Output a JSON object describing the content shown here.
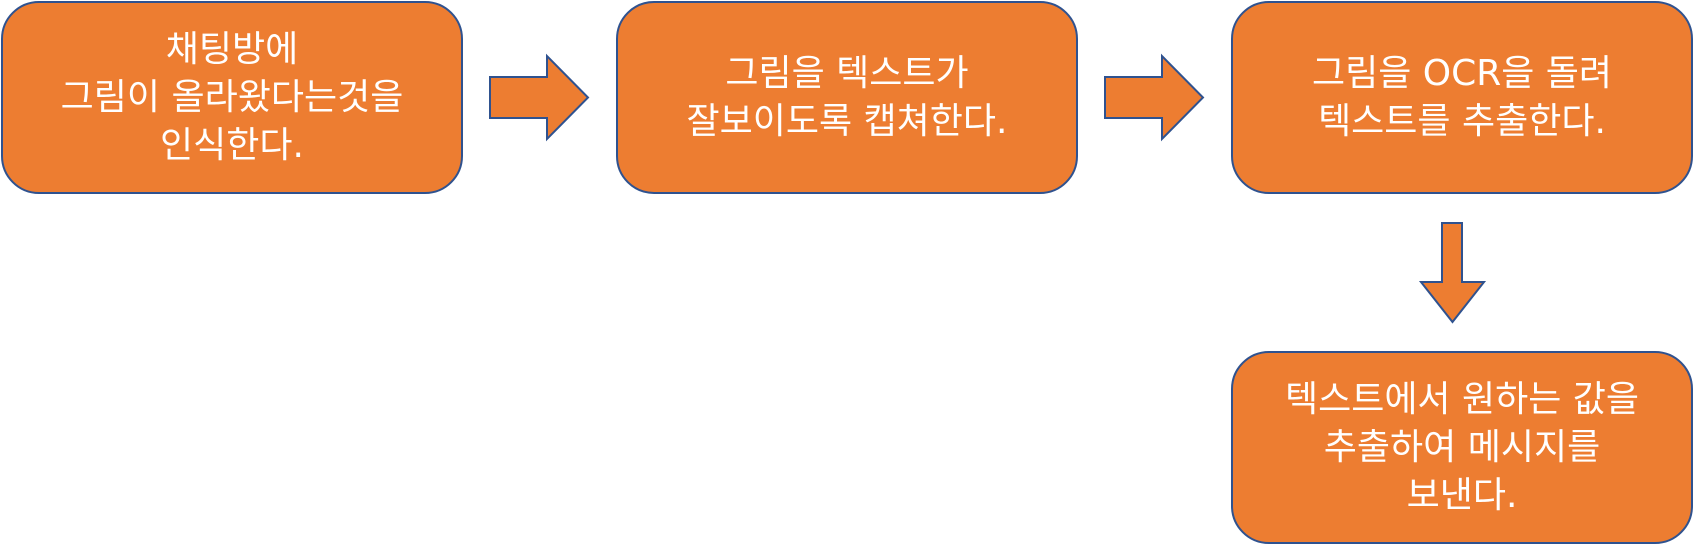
{
  "colors": {
    "box_fill": "#ED7D31",
    "box_border": "#2F528F",
    "text": "#FFFFFF",
    "arrow_fill": "#ED7D31",
    "arrow_border": "#2F528F"
  },
  "steps": [
    {
      "lines": [
        "채팅방에",
        "그림이 올라왔다는것을",
        "인식한다."
      ]
    },
    {
      "lines": [
        "그림을 텍스트가",
        "잘보이도록 캡쳐한다."
      ]
    },
    {
      "lines": [
        "그림을 OCR을 돌려",
        "텍스트를 추출한다."
      ]
    },
    {
      "lines": [
        "텍스트에서 원하는 값을",
        "추출하여 메시지를",
        "보낸다."
      ]
    }
  ],
  "arrows": [
    {
      "from": "step-1",
      "to": "step-2",
      "direction": "right"
    },
    {
      "from": "step-2",
      "to": "step-3",
      "direction": "right"
    },
    {
      "from": "step-3",
      "to": "step-4",
      "direction": "down"
    }
  ]
}
